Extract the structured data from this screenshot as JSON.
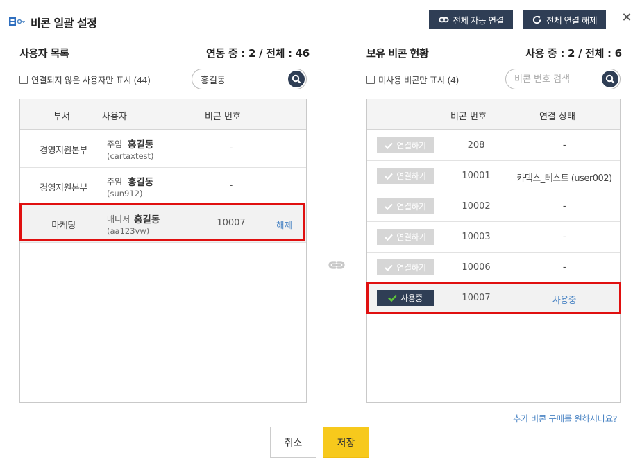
{
  "header": {
    "title": "비콘 일괄 설정",
    "auto_connect_label": "전체 자동 연결",
    "release_all_label": "전체 연결 해제",
    "close_label": "✕"
  },
  "users": {
    "title": "사용자 목록",
    "count": "연동 중 : 2 / 전체 : 46",
    "filter_label": "연결되지 않은 사용자만 표시 (44)",
    "search_value": "홍길동",
    "columns": [
      "부서",
      "사용자",
      "비콘 번호"
    ],
    "rows": [
      {
        "dept": "경영지원본부",
        "role": "주임",
        "name": "홍길동",
        "id": "(cartaxtest)",
        "beacon": "-",
        "action": ""
      },
      {
        "dept": "경영지원본부",
        "role": "주임",
        "name": "홍길동",
        "id": "(sun912)",
        "beacon": "-",
        "action": ""
      },
      {
        "dept": "마케팅",
        "role": "매니저",
        "name": "홍길동",
        "id": "(aa123vw)",
        "beacon": "10007",
        "action": "해제"
      }
    ]
  },
  "beacons": {
    "title": "보유 비콘 현황",
    "count": "사용 중 : 2 / 전체 : 6",
    "filter_label": "미사용 비콘만 표시 (4)",
    "search_placeholder": "비콘 번호 검색",
    "columns": [
      "비콘 번호",
      "연결 상태"
    ],
    "rows": [
      {
        "button": "연결하기",
        "number": "208",
        "status": "-"
      },
      {
        "button": "연결하기",
        "number": "10001",
        "status": "카택스_테스트 (user002)"
      },
      {
        "button": "연결하기",
        "number": "10002",
        "status": "-"
      },
      {
        "button": "연결하기",
        "number": "10003",
        "status": "-"
      },
      {
        "button": "연결하기",
        "number": "10006",
        "status": "-"
      },
      {
        "button": "사용중",
        "number": "10007",
        "status": "사용중"
      }
    ]
  },
  "footer": {
    "more_link": "추가 비콘 구매를 원하시나요?",
    "cancel_label": "취소",
    "save_label": "저장"
  },
  "colors": {
    "primary_dark": "#2f3e55",
    "save_yellow": "#f7c91c",
    "link_blue": "#4a84c4",
    "highlight_red": "#e01010",
    "disabled_gray": "#d6d6d6"
  }
}
